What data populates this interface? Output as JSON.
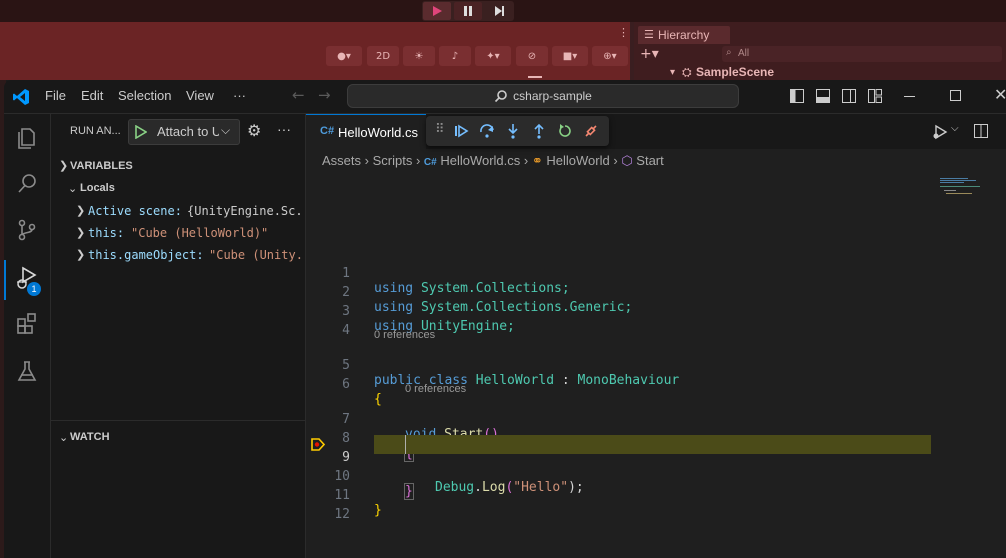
{
  "unity": {
    "toolbar_2d": "2D",
    "hierarchy_title": "Hierarchy",
    "hierarchy_search_placeholder": "All",
    "scene_name": "SampleScene"
  },
  "titlebar": {
    "menus": [
      "File",
      "Edit",
      "Selection",
      "View",
      "···"
    ],
    "search_text": "csharp-sample"
  },
  "activity": {
    "debug_badge": "1"
  },
  "sidebar": {
    "run_title": "RUN AN...",
    "attach_label": "Attach to U",
    "variables_title": "VARIABLES",
    "locals_title": "Locals",
    "locals": [
      {
        "name": "Active scene:",
        "value": "{UnityEngine.Sc..."
      },
      {
        "name": "this:",
        "value": "\"Cube (HelloWorld)\""
      },
      {
        "name": "this.gameObject:",
        "value": "\"Cube (Unity..."
      }
    ],
    "watch_title": "WATCH"
  },
  "editor": {
    "tab_label": "HelloWorld.cs",
    "breadcrumb": [
      "Assets",
      "Scripts",
      "HelloWorld.cs",
      "HelloWorld",
      "Start"
    ],
    "references_label": "0 references",
    "current_line": "9",
    "line_numbers": [
      "1",
      "2",
      "3",
      "4",
      "5",
      "6",
      "7",
      "8",
      "9",
      "10",
      "11",
      "12"
    ],
    "code": {
      "l1_kw": "using",
      "l1_ns": "System.Collections;",
      "l2_kw": "using",
      "l2_ns": "System.Collections.Generic;",
      "l3_kw": "using",
      "l3_ns": "UnityEngine;",
      "l5_kw": "public class",
      "l5_cls": "HelloWorld",
      "l5_colon": " : ",
      "l5_base": "MonoBehaviour",
      "l6": "{",
      "l7_kw": "void",
      "l7_fn": "Start",
      "l7_paren": "()",
      "l8": "{",
      "l9_cls": "Debug",
      "l9_dot": ".",
      "l9_fn": "Log",
      "l9_open": "(",
      "l9_str": "\"Hello\"",
      "l9_close": ");",
      "l10": "}",
      "l11": "}"
    }
  },
  "colors": {
    "accent": "#0078d4",
    "current_line_bg": "#4b4b18",
    "breakpoint": "#ffcc00"
  }
}
